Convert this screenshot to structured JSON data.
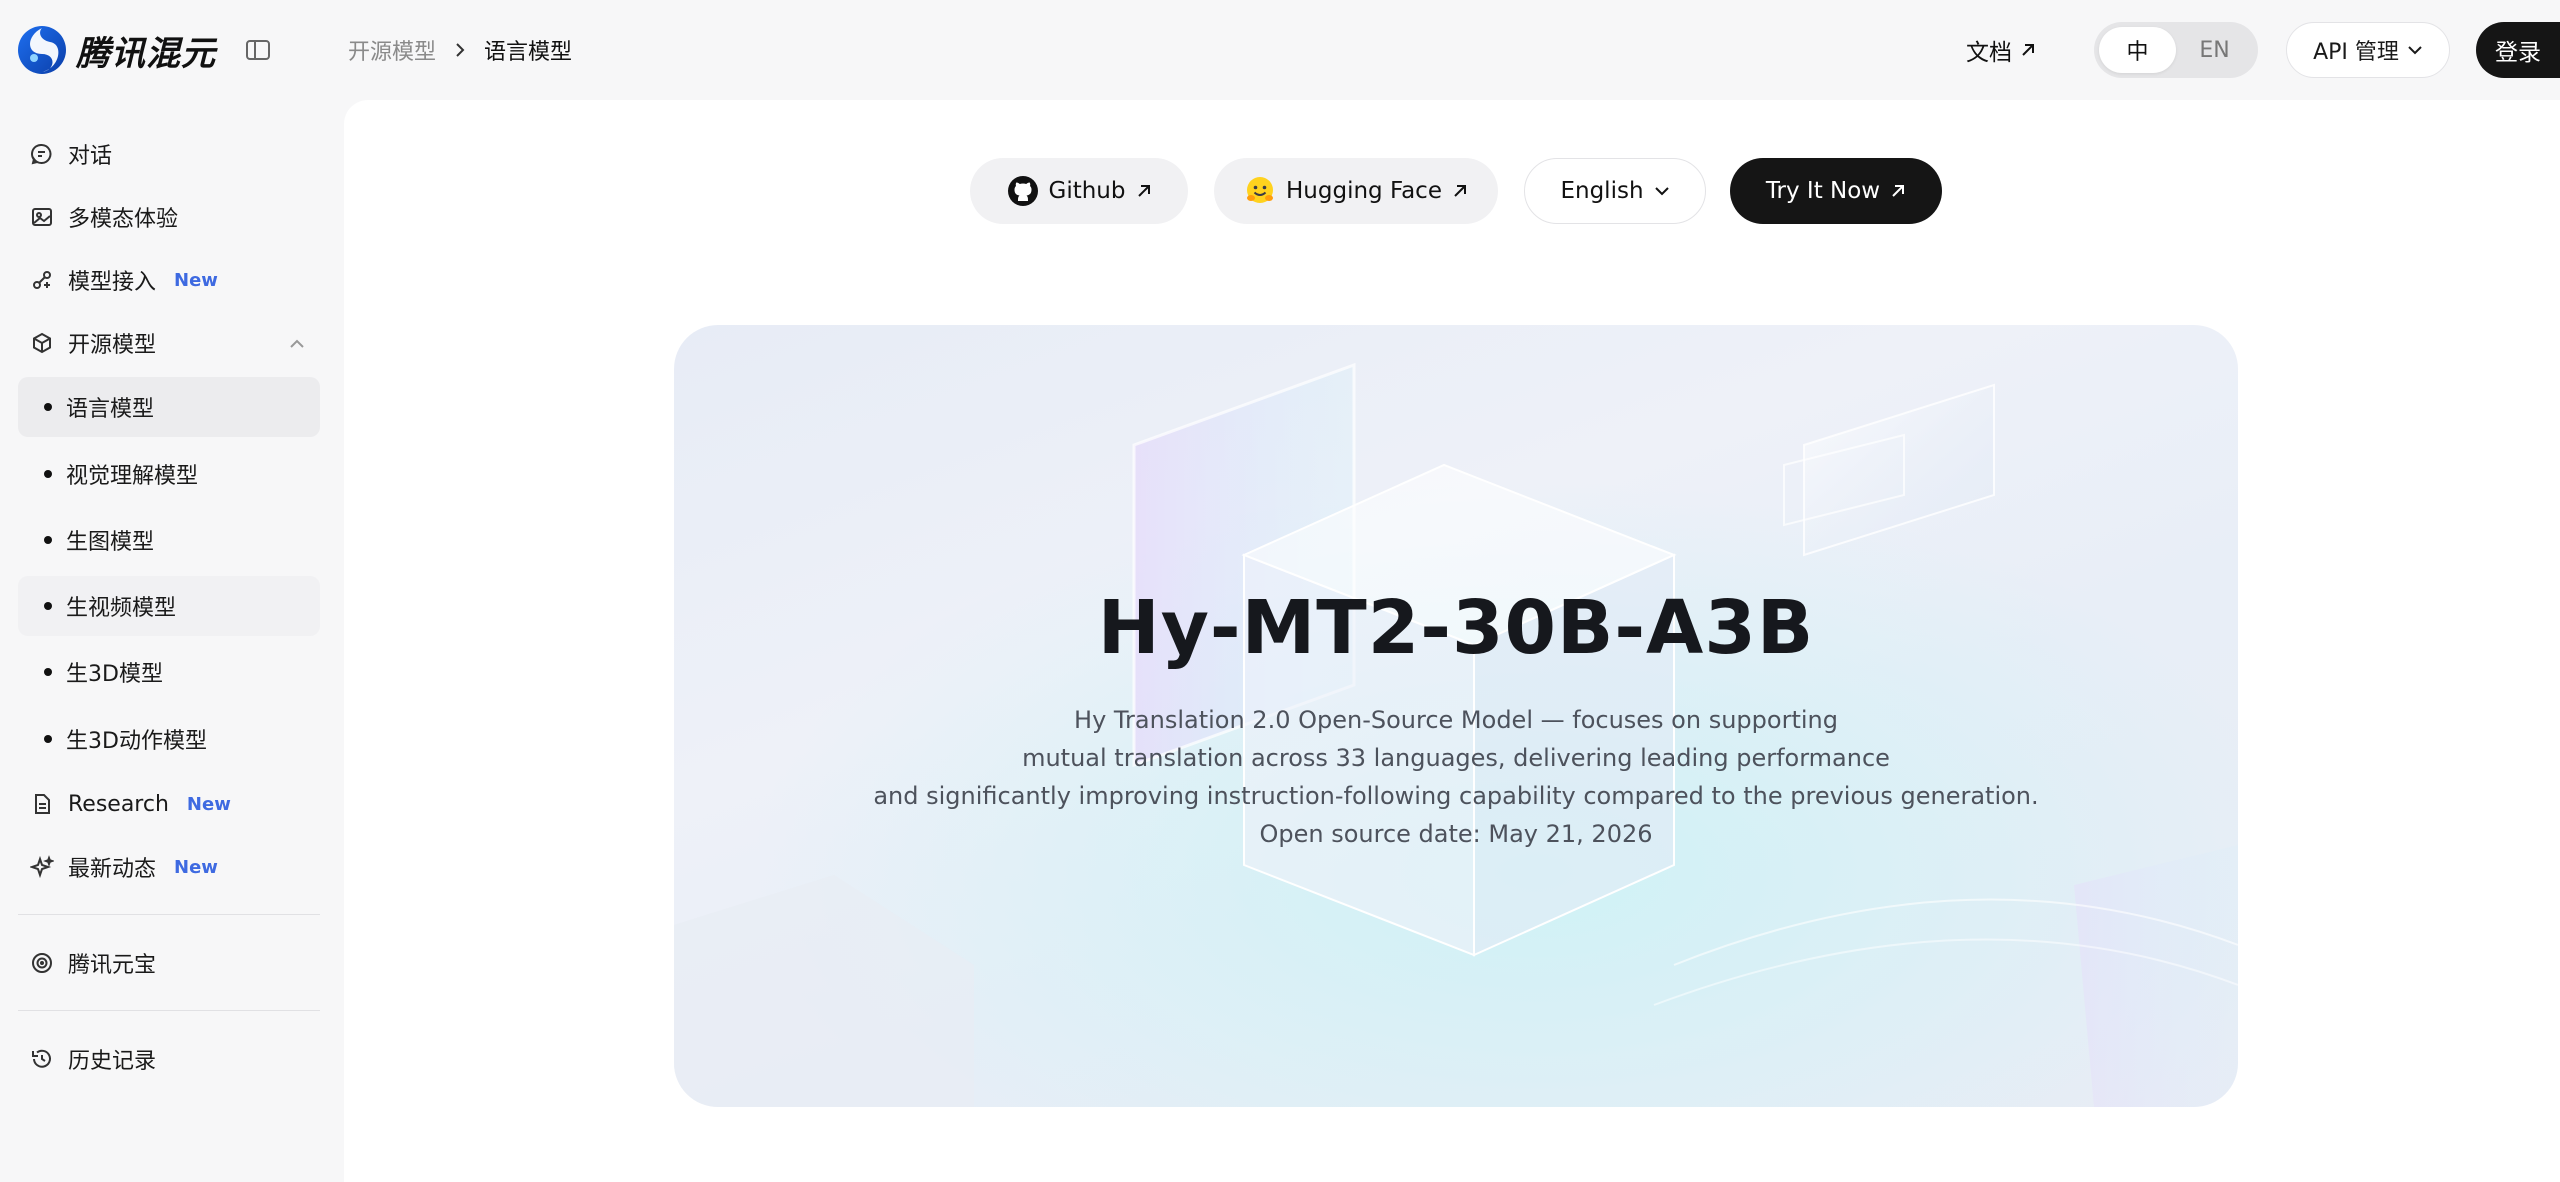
{
  "brand": {
    "name": "腾讯混元"
  },
  "breadcrumb": {
    "parent": "开源模型",
    "current": "语言模型"
  },
  "header": {
    "docs_label": "文档",
    "lang_options": [
      "中",
      "EN"
    ],
    "lang_selected": "中",
    "api_label": "API 管理",
    "login_label": "登录"
  },
  "sidebar": {
    "new_badge": "New",
    "items": [
      {
        "label": "对话",
        "icon": "chat-icon"
      },
      {
        "label": "多模态体验",
        "icon": "image-icon"
      },
      {
        "label": "模型接入",
        "icon": "plug-icon",
        "badge": "New"
      },
      {
        "label": "开源模型",
        "icon": "cube-icon",
        "expanded": true
      }
    ],
    "sub_items": [
      {
        "label": "语言模型",
        "active": true
      },
      {
        "label": "视觉理解模型"
      },
      {
        "label": "生图模型"
      },
      {
        "label": "生视频模型"
      },
      {
        "label": "生3D模型"
      },
      {
        "label": "生3D动作模型"
      }
    ],
    "bottom_items": [
      {
        "label": "Research",
        "icon": "document-icon",
        "badge": "New"
      },
      {
        "label": "最新动态",
        "icon": "sparkle-icon",
        "badge": "New"
      }
    ],
    "yuanbao": {
      "label": "腾讯元宝",
      "icon": "yuanbao-icon"
    },
    "history": {
      "label": "历史记录",
      "icon": "history-icon"
    }
  },
  "actions": {
    "github": "Github",
    "huggingface": "Hugging Face",
    "language": "English",
    "try_now": "Try It Now"
  },
  "hero": {
    "title": "Hy-MT2-30B-A3B",
    "desc_lines": [
      "Hy Translation 2.0 Open-Source Model — focuses on supporting",
      "mutual translation across 33 languages, delivering leading performance",
      "and significantly improving instruction-following capability compared to the previous generation.",
      "Open source date: May 21, 2026"
    ]
  },
  "colors": {
    "accent_new": "#3e6ae1",
    "dark_button": "#151515"
  }
}
